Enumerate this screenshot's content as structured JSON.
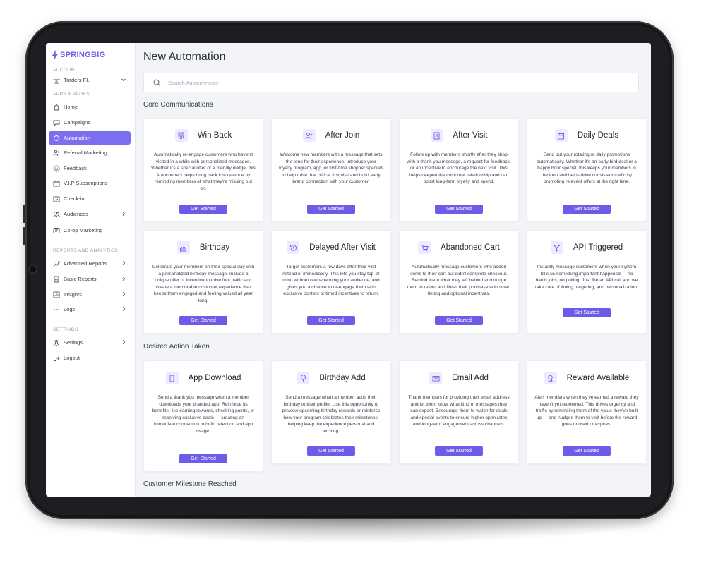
{
  "brand": {
    "name": "SPRINGBIG",
    "accent": "#6c5ce7"
  },
  "sidebar": {
    "sections": {
      "account": "ACCOUNT",
      "apps": "APPS & PAGES",
      "reports": "REPORTS AND ANALYTICS",
      "settings": "SETTINGS"
    },
    "account": {
      "label": "Traders FL",
      "icon": "store-icon"
    },
    "items": [
      {
        "label": "Home",
        "icon": "home-icon"
      },
      {
        "label": "Campaigns",
        "icon": "chat-icon"
      },
      {
        "label": "Automation",
        "icon": "automation-icon",
        "active": true
      },
      {
        "label": "Referral Marketing",
        "icon": "user-plus-icon"
      },
      {
        "label": "Feedback",
        "icon": "smile-icon"
      },
      {
        "label": "V.I.P Subscriptions",
        "icon": "calendar-icon"
      },
      {
        "label": "Check-in",
        "icon": "calendar-check-icon"
      },
      {
        "label": "Audiences",
        "icon": "users-icon"
      },
      {
        "label": "Co-op Marketing",
        "icon": "co-op-icon"
      },
      {
        "label": "Advanced Reports",
        "icon": "chart-icon"
      },
      {
        "label": "Basic Reports",
        "icon": "report-icon"
      },
      {
        "label": "Insights",
        "icon": "insights-icon"
      },
      {
        "label": "Logs",
        "icon": "dots-icon"
      },
      {
        "label": "Settings",
        "icon": "gear-icon"
      },
      {
        "label": "Logout",
        "icon": "logout-icon"
      }
    ]
  },
  "main": {
    "title": "New Automation",
    "search_placeholder": "Search Autoconnects",
    "sections": [
      "Core Communications",
      "Desired Action Taken",
      "Customer Milestone Reached"
    ],
    "button_label": "Get Started",
    "cards": [
      {
        "title": "Win Back",
        "icon": "magnet-icon",
        "desc": "Automatically re-engage customers who haven't visited in a while with personalized messages. Whether it's a special offer or a friendly nudge, this Autoconnect helps bring back lost revenue by reminding members of what they're missing out on."
      },
      {
        "title": "After Join",
        "icon": "user-plus-icon",
        "desc": "Welcome new members with a message that sets the tone for their experience. Introduce your loyalty program, app, or first-time shopper specials to help drive that critical first visit and build early brand connection with your customer."
      },
      {
        "title": "After Visit",
        "icon": "receipt-icon",
        "desc": "Follow up with members shortly after they shop with a thank you message, a request for feedback, or an incentive to encourage the next visit. This helps deepen the customer relationship and can boost long-term loyalty and spend."
      },
      {
        "title": "Daily Deals",
        "icon": "calendar-icon",
        "desc": "Send out your rotating or daily promotions automatically. Whether it's an early bird deal or a happy hour special, this keeps your members in the loop and helps drive consistent traffic by promoting relevant offers at the right time."
      },
      {
        "title": "Birthday",
        "icon": "cake-icon",
        "desc": "Celebrate your members on their special day with a personalized birthday message. Include a unique offer or incentive to drive foot traffic and create a memorable customer experience that keeps them engaged and feeling valued all year long."
      },
      {
        "title": "Delayed After Visit",
        "icon": "clock-history-icon",
        "desc": "Target customers a few days after their visit instead of immediately. This lets you stay top-of-mind without overwhelming your audience, and gives you a chance to re-engage them with exclusive content or timed incentives to return."
      },
      {
        "title": "Abandoned Cart",
        "icon": "cart-icon",
        "desc": "Automatically message customers who added items to their cart but didn't complete checkout. Remind them what they left behind and nudge them to return and finish their purchase with smart timing and optional incentives."
      },
      {
        "title": "API Triggered",
        "icon": "api-icon",
        "desc": "Instantly message customers when your system tells us something important happened — no batch jobs, no polling. Just fire an API call and we take care of timing, targeting, and personalization."
      },
      {
        "title": "App Download",
        "icon": "phone-icon",
        "desc": "Send a thank you message when a member downloads your branded app. Reinforce its benefits, like earning rewards, checking points, or receiving exclusive deals — creating an immediate connection to build retention and app usage."
      },
      {
        "title": "Birthday Add",
        "icon": "balloon-icon",
        "desc": "Send a message when a member adds their birthday to their profile. Use this opportunity to preview upcoming birthday rewards or reinforce how your program celebrates their milestones, helping keep the experience personal and exciting."
      },
      {
        "title": "Email Add",
        "icon": "mail-icon",
        "desc": "Thank members for providing their email address and let them know what kind of messages they can expect. Encourage them to watch for deals and special events to ensure higher open rates and long-term engagement across channels."
      },
      {
        "title": "Reward Available",
        "icon": "medal-icon",
        "desc": "Alert members when they've earned a reward they haven't yet redeemed. This drives urgency and traffic by reminding them of the value they've built up — and nudges them to visit before the reward goes unused or expires."
      }
    ]
  }
}
